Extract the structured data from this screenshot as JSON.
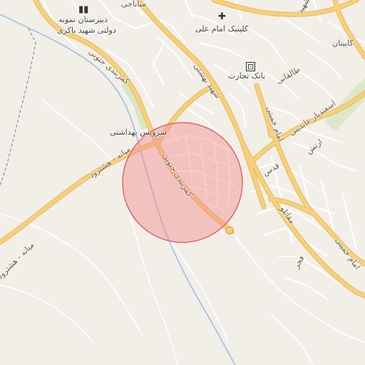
{
  "map": {
    "colors": {
      "background": "#f2efe9",
      "minor_road": "#ffffff",
      "major_road": "#f6d07a",
      "trunk_road": "#f3c165",
      "river": "#9cc0e6",
      "green": "#cfe3b8",
      "boundary": "#8a8a9a",
      "circle_fill": "#f28c8c",
      "circle_stroke": "#e06666"
    },
    "marker": {
      "type": "radius-circle"
    },
    "icons": {
      "school": "school-icon",
      "clinic": "clinic-cross-icon",
      "bank": "bank-icon"
    },
    "labels": {
      "school_line1": "دبیرستان نمونه",
      "school_line2": "دولتی شهید باکری",
      "clinic": "کلینیک امام علی",
      "bank": "بانک تجارت",
      "health_service": "سرویس بهداشتی",
      "road_mianeh_top": "میانه - هشترود",
      "road_mianeh_left": "میانه - هشترود",
      "kamarbandi_top": "کمربندی جنوبی",
      "kamarbandi_mid": "کمربندی جنوبی",
      "shahid_beheshti": "شهید بهشتی",
      "taleghani": "طالقانی",
      "imam_khomeini_top": "امام خمینی",
      "imam_khomeini_bottom": "امام خمینی",
      "esfandiyar": "اسفندیار عابدینی",
      "artesh": "ارتش",
      "qods": "قدس",
      "moghaddam": "مقاتلو",
      "fajr": "فجر",
      "capitan": "کاپیتان",
      "mianaji": "میاناجی",
      "corner_top_right": "شهید"
    }
  }
}
